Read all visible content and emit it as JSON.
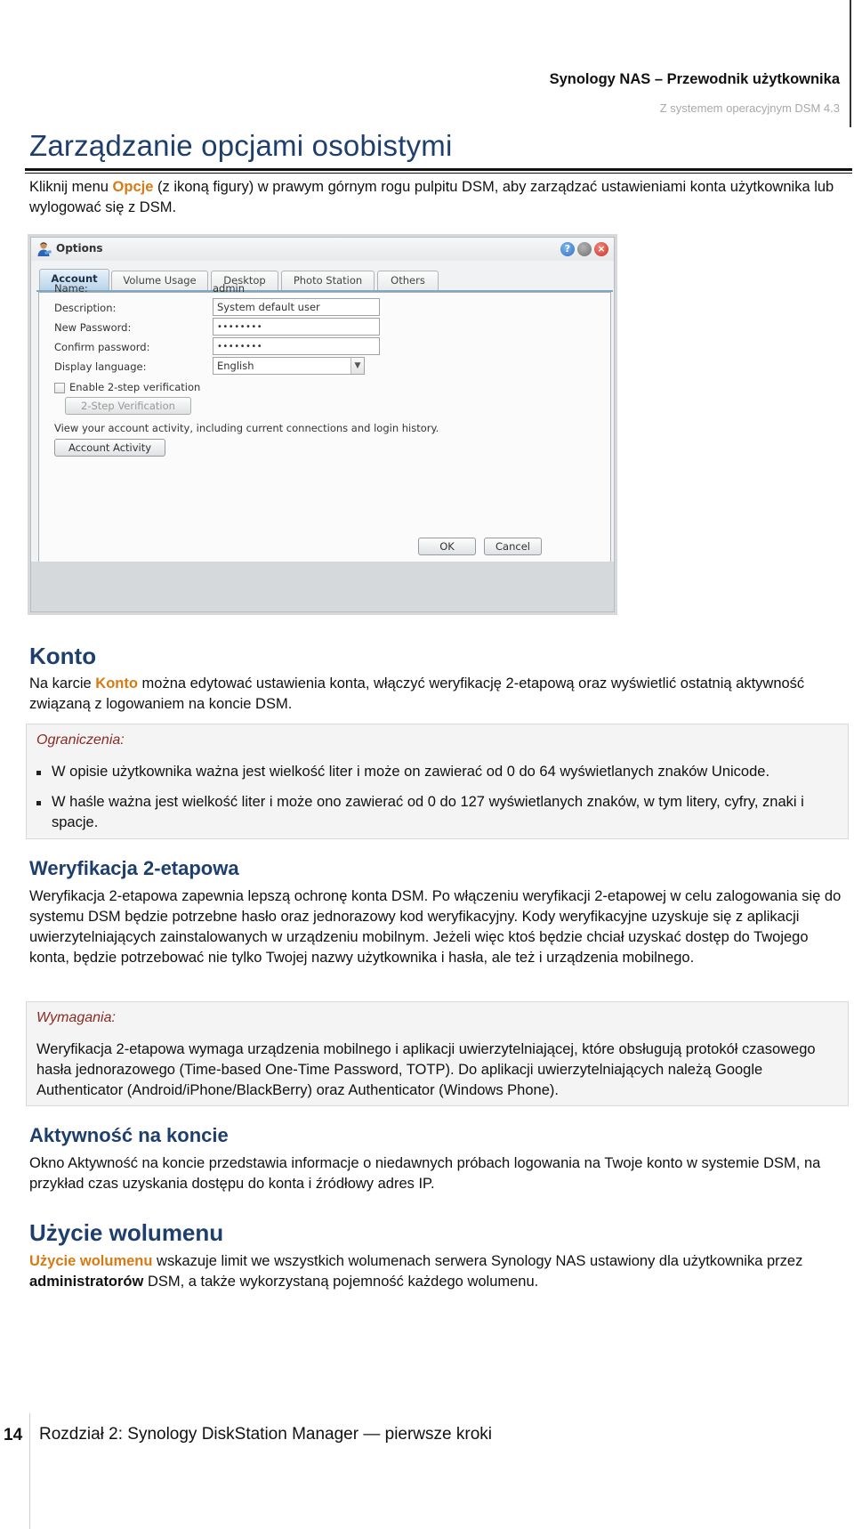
{
  "header": {
    "title": "Synology NAS – Przewodnik użytkownika",
    "subtitle": "Z systemem operacyjnym DSM 4.3"
  },
  "page_title": "Zarządzanie opcjami osobistymi",
  "intro": {
    "before": "Kliknij menu ",
    "highlight": "Opcje",
    "after": " (z ikoną figury) w prawym górnym rogu pulpitu DSM, aby zarządzać ustawieniami konta użytkownika lub wylogować się z DSM."
  },
  "dialog": {
    "title": "Options",
    "icons": [
      "user-icon",
      "help-icon",
      "minimize-icon",
      "close-icon"
    ],
    "tabs": [
      {
        "label": "Account",
        "active": true
      },
      {
        "label": "Volume Usage",
        "active": false
      },
      {
        "label": "Desktop",
        "active": false
      },
      {
        "label": "Photo Station",
        "active": false
      },
      {
        "label": "Others",
        "active": false
      }
    ],
    "fields": {
      "name_label": "Name:",
      "name_value": "admin",
      "description_label": "Description:",
      "description_value": "System default user",
      "new_password_label": "New Password:",
      "new_password_value": "••••••••",
      "confirm_password_label": "Confirm password:",
      "confirm_password_value": "••••••••",
      "display_language_label": "Display language:",
      "display_language_value": "English"
    },
    "enable_2step_label": "Enable 2-step verification",
    "enable_2step_checked": false,
    "two_step_button": "2-Step Verification",
    "activity_text": "View your account activity, including current connections and login history.",
    "account_activity_button": "Account Activity",
    "ok_button": "OK",
    "cancel_button": "Cancel"
  },
  "sections": {
    "konto": {
      "heading": "Konto",
      "before": "Na karcie ",
      "highlight": "Konto",
      "after": " można edytować ustawienia konta, włączyć weryfikację 2-etapową oraz wyświetlić ostatnią aktywność związaną z logowaniem na koncie DSM."
    },
    "limitations": {
      "title": "Ograniczenia:",
      "items": [
        "W opisie użytkownika ważna jest wielkość liter i może on zawierać od 0 do 64 wyświetlanych znaków Unicode.",
        "W haśle ważna jest wielkość liter i może ono zawierać od 0 do 127 wyświetlanych znaków, w tym litery, cyfry, znaki i spacje."
      ]
    },
    "two_step": {
      "heading": "Weryfikacja 2-etapowa",
      "text": "Weryfikacja 2-etapowa zapewnia lepszą ochronę konta DSM. Po włączeniu weryfikacji 2-etapowej w celu zalogowania się do systemu DSM będzie potrzebne hasło oraz jednorazowy kod weryfikacyjny. Kody weryfikacyjne uzyskuje się z aplikacji uwierzytelniających zainstalowanych w urządzeniu mobilnym. Jeżeli więc ktoś będzie chciał uzyskać dostęp do Twojego konta, będzie potrzebować nie tylko Twojej nazwy użytkownika i hasła, ale też i urządzenia mobilnego."
    },
    "requirements": {
      "title": "Wymagania:",
      "text": "Weryfikacja 2-etapowa wymaga urządzenia mobilnego i aplikacji uwierzytelniającej, które obsługują protokół czasowego hasła jednorazowego (Time-based One-Time Password, TOTP). Do aplikacji uwierzytelniających należą Google Authenticator (Android/iPhone/BlackBerry) oraz Authenticator (Windows Phone)."
    },
    "activity": {
      "heading": "Aktywność na koncie",
      "text": "Okno Aktywność na koncie przedstawia informacje o niedawnych próbach logowania na Twoje konto w systemie DSM, na przykład czas uzyskania dostępu do konta i źródłowy adres IP."
    },
    "volume": {
      "heading": "Użycie wolumenu",
      "highlight": "Użycie wolumenu",
      "middle": " wskazuje limit we wszystkich wolumenach serwera Synology NAS ustawiony dla użytkownika przez ",
      "bold": "administratorów",
      "after": " DSM, a także wykorzystaną pojemność każdego wolumenu."
    }
  },
  "footer": {
    "page_number": "14",
    "chapter": "Rozdział 2: Synology DiskStation Manager — pierwsze kroki"
  },
  "colors": {
    "heading_blue": "#1e3f6e",
    "highlight_orange": "#d87a13",
    "note_title_red": "#8c2a22",
    "note_background": "#f4f4f4"
  }
}
